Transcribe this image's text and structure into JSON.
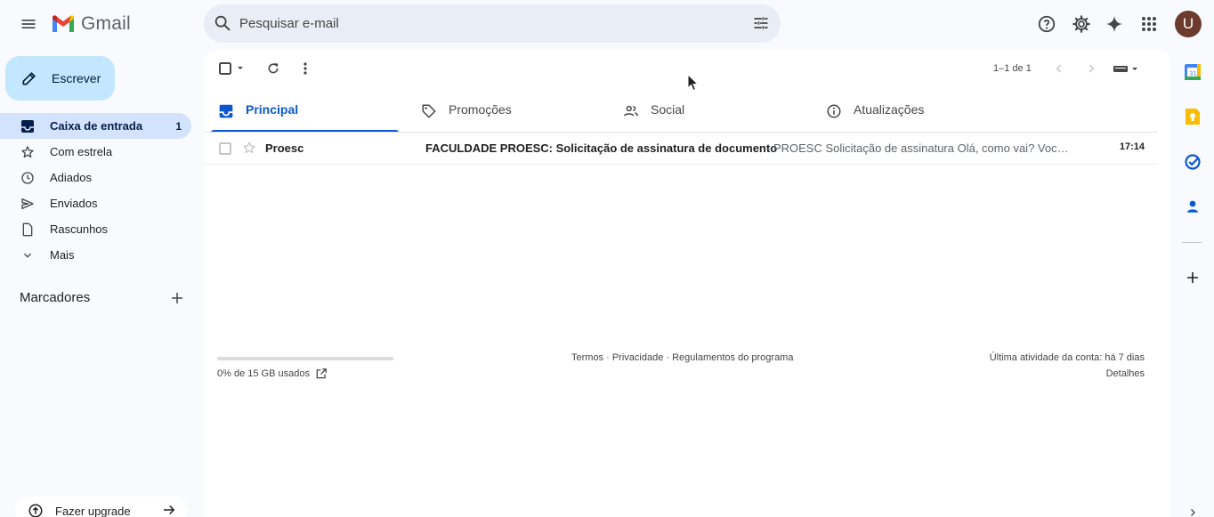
{
  "app": {
    "name": "Gmail",
    "avatar_letter": "U"
  },
  "search": {
    "placeholder": "Pesquisar e-mail"
  },
  "compose": {
    "label": "Escrever"
  },
  "nav": {
    "items": [
      {
        "label": "Caixa de entrada",
        "count": "1",
        "icon": "inbox-icon",
        "active": true
      },
      {
        "label": "Com estrela",
        "count": "",
        "icon": "star-icon",
        "active": false
      },
      {
        "label": "Adiados",
        "count": "",
        "icon": "clock-icon",
        "active": false
      },
      {
        "label": "Enviados",
        "count": "",
        "icon": "send-icon",
        "active": false
      },
      {
        "label": "Rascunhos",
        "count": "",
        "icon": "draft-icon",
        "active": false
      },
      {
        "label": "Mais",
        "count": "",
        "icon": "chevron-down-icon",
        "active": false
      }
    ],
    "labels_heading": "Marcadores",
    "upgrade_label": "Fazer upgrade"
  },
  "toolbar": {
    "pagination": "1–1 de 1"
  },
  "tabs": [
    {
      "label": "Principal",
      "icon": "inbox-icon",
      "active": true
    },
    {
      "label": "Promoções",
      "icon": "tag-icon",
      "active": false
    },
    {
      "label": "Social",
      "icon": "people-icon",
      "active": false
    },
    {
      "label": "Atualizações",
      "icon": "info-icon",
      "active": false
    }
  ],
  "emails": [
    {
      "sender": "Proesc",
      "subject": "FACULDADE PROESC: Solicitação de assinatura de documento",
      "snippet": " - PROESC Solicitação de assinatura Olá, como vai? Você recebeu uma solicitação",
      "time": "17:14",
      "starred": false,
      "unread": true
    }
  ],
  "footer": {
    "storage_text": "0% de 15 GB usados",
    "storage_used_fraction": 0.0,
    "terms": "Termos",
    "privacy": "Privacidade",
    "program_policies": "Regulamentos do programa",
    "separator": " · ",
    "last_activity": "Última atividade da conta: há 7 dias",
    "details": "Detalhes"
  },
  "colors": {
    "accent": "#0b57d0",
    "compose_bg": "#c2e7ff",
    "active_nav_bg": "#d3e3fd",
    "page_bg": "#f8fafd"
  }
}
